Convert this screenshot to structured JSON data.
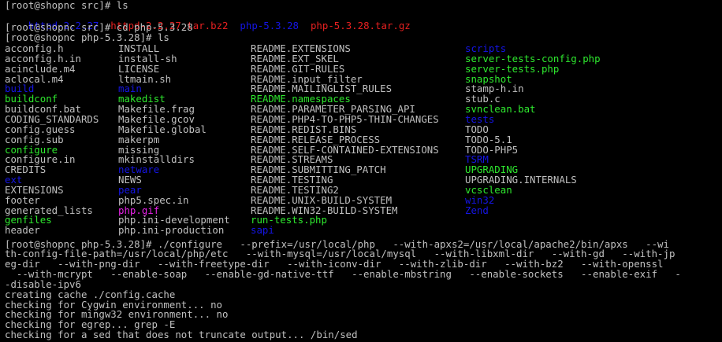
{
  "terminal": {
    "lines": [
      "[root@shopnc src]# ls",
      null,
      "[root@shopnc src]# cd php-5.3.28",
      "[root@shopnc php-5.3.28]# ls"
    ],
    "top_files": [
      {
        "name": "httpd-2.2.27",
        "color": "blue"
      },
      {
        "name": "httpd-2.2.27.tar.bz2",
        "color": "red"
      },
      {
        "name": "php-5.3.28",
        "color": "blue"
      },
      {
        "name": "php-5.3.28.tar.gz",
        "color": "red"
      }
    ],
    "ls_columns": [
      [
        {
          "name": "acconfig.h",
          "color": "white"
        },
        {
          "name": "acconfig.h.in",
          "color": "white"
        },
        {
          "name": "acinclude.m4",
          "color": "white"
        },
        {
          "name": "aclocal.m4",
          "color": "white"
        },
        {
          "name": "build",
          "color": "blue"
        },
        {
          "name": "buildconf",
          "color": "green"
        },
        {
          "name": "buildconf.bat",
          "color": "white"
        },
        {
          "name": "CODING_STANDARDS",
          "color": "white"
        },
        {
          "name": "config.guess",
          "color": "white"
        },
        {
          "name": "config.sub",
          "color": "white"
        },
        {
          "name": "configure",
          "color": "green"
        },
        {
          "name": "configure.in",
          "color": "white"
        },
        {
          "name": "CREDITS",
          "color": "white"
        },
        {
          "name": "ext",
          "color": "blue"
        },
        {
          "name": "EXTENSIONS",
          "color": "white"
        },
        {
          "name": "footer",
          "color": "white"
        },
        {
          "name": "generated_lists",
          "color": "white"
        },
        {
          "name": "genfiles",
          "color": "green"
        },
        {
          "name": "header",
          "color": "white"
        }
      ],
      [
        {
          "name": "INSTALL",
          "color": "white"
        },
        {
          "name": "install-sh",
          "color": "white"
        },
        {
          "name": "LICENSE",
          "color": "white"
        },
        {
          "name": "ltmain.sh",
          "color": "white"
        },
        {
          "name": "main",
          "color": "blue"
        },
        {
          "name": "makedist",
          "color": "green"
        },
        {
          "name": "Makefile.frag",
          "color": "white"
        },
        {
          "name": "Makefile.gcov",
          "color": "white"
        },
        {
          "name": "Makefile.global",
          "color": "white"
        },
        {
          "name": "makerpm",
          "color": "white"
        },
        {
          "name": "missing",
          "color": "white"
        },
        {
          "name": "mkinstalldirs",
          "color": "white"
        },
        {
          "name": "netware",
          "color": "blue"
        },
        {
          "name": "NEWS",
          "color": "white"
        },
        {
          "name": "pear",
          "color": "blue"
        },
        {
          "name": "php5.spec.in",
          "color": "white"
        },
        {
          "name": "php.gif",
          "color": "magenta"
        },
        {
          "name": "php.ini-development",
          "color": "white"
        },
        {
          "name": "php.ini-production",
          "color": "white"
        }
      ],
      [
        {
          "name": "README.EXTENSIONS",
          "color": "white"
        },
        {
          "name": "README.EXT_SKEL",
          "color": "white"
        },
        {
          "name": "README.GIT-RULES",
          "color": "white"
        },
        {
          "name": "README.input_filter",
          "color": "white"
        },
        {
          "name": "README.MAILINGLIST_RULES",
          "color": "white"
        },
        {
          "name": "README.namespaces",
          "color": "green"
        },
        {
          "name": "README.PARAMETER_PARSING_API",
          "color": "white"
        },
        {
          "name": "README.PHP4-TO-PHP5-THIN-CHANGES",
          "color": "white"
        },
        {
          "name": "README.REDIST.BINS",
          "color": "white"
        },
        {
          "name": "README.RELEASE_PROCESS",
          "color": "white"
        },
        {
          "name": "README.SELF-CONTAINED-EXTENSIONS",
          "color": "white"
        },
        {
          "name": "README.STREAMS",
          "color": "white"
        },
        {
          "name": "README.SUBMITTING_PATCH",
          "color": "white"
        },
        {
          "name": "README.TESTING",
          "color": "white"
        },
        {
          "name": "README.TESTING2",
          "color": "white"
        },
        {
          "name": "README.UNIX-BUILD-SYSTEM",
          "color": "white"
        },
        {
          "name": "README.WIN32-BUILD-SYSTEM",
          "color": "white"
        },
        {
          "name": "run-tests.php",
          "color": "green"
        },
        {
          "name": "sapi",
          "color": "blue"
        }
      ],
      [
        {
          "name": "scripts",
          "color": "blue"
        },
        {
          "name": "server-tests-config.php",
          "color": "green"
        },
        {
          "name": "server-tests.php",
          "color": "green"
        },
        {
          "name": "snapshot",
          "color": "green"
        },
        {
          "name": "stamp-h.in",
          "color": "white"
        },
        {
          "name": "stub.c",
          "color": "white"
        },
        {
          "name": "svnclean.bat",
          "color": "green"
        },
        {
          "name": "tests",
          "color": "blue"
        },
        {
          "name": "TODO",
          "color": "white"
        },
        {
          "name": "TODO-5.1",
          "color": "white"
        },
        {
          "name": "TODO-PHP5",
          "color": "white"
        },
        {
          "name": "TSRM",
          "color": "blue"
        },
        {
          "name": "UPGRADING",
          "color": "green"
        },
        {
          "name": "UPGRADING.INTERNALS",
          "color": "white"
        },
        {
          "name": "vcsclean",
          "color": "green"
        },
        {
          "name": "win32",
          "color": "blue"
        },
        {
          "name": "Zend",
          "color": "blue"
        }
      ]
    ],
    "after_lines": [
      "[root@shopnc php-5.3.28]# ./configure   --prefix=/usr/local/php   --with-apxs2=/usr/local/apache2/bin/apxs   --wi",
      "th-config-file-path=/usr/local/php/etc   --with-mysql=/usr/local/mysql   --with-libxml-dir   --with-gd   --with-jp",
      "eg-dir   --with-png-dir   --with-freetype-dir   --with-iconv-dir   --with-zlib-dir   --with-bz2   --with-openssl",
      "  --with-mcrypt   --enable-soap   --enable-gd-native-ttf   --enable-mbstring   --enable-sockets   --enable-exif   -",
      "-disable-ipv6",
      "creating cache ./config.cache",
      "checking for Cygwin environment... no",
      "checking for mingw32 environment... no",
      "checking for egrep... grep -E",
      "checking for a sed that does not truncate output... /bin/sed"
    ],
    "colors": {
      "background": "#000000",
      "text": "#c0c0c0",
      "directory": "#1515e6",
      "executable": "#2ee82e",
      "archive": "#e62020",
      "image": "#e622e6"
    }
  }
}
